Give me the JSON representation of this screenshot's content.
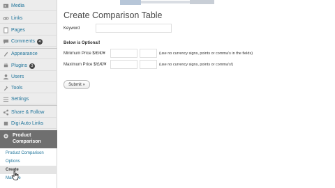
{
  "sidebar": {
    "items": [
      {
        "label": "Media",
        "icon": "media-icon"
      },
      {
        "label": "Links",
        "icon": "links-icon"
      },
      {
        "label": "Pages",
        "icon": "pages-icon"
      },
      {
        "label": "Comments",
        "icon": "comments-icon",
        "badge": "4"
      },
      {
        "label": "Appearance",
        "icon": "appearance-icon"
      },
      {
        "label": "Plugins",
        "icon": "plugins-icon",
        "badge": "3"
      },
      {
        "label": "Users",
        "icon": "users-icon"
      },
      {
        "label": "Tools",
        "icon": "tools-icon"
      },
      {
        "label": "Settings",
        "icon": "settings-icon"
      },
      {
        "label": "Share & Follow",
        "icon": "share-icon"
      },
      {
        "label": "Digi Auto Links",
        "icon": "links-plugin-icon"
      }
    ],
    "active_group": {
      "label_line1": "Product",
      "label_line2": "Comparison"
    },
    "submenu": [
      "Product Comparison",
      "Options",
      "Create",
      "Manage"
    ]
  },
  "main": {
    "title": "Create Comparison Table",
    "keyword_label": "Keyword",
    "optional_heading": "Below is Optional!",
    "min_price_label": "Minimum Price  $/£/€/¥",
    "max_price_label": "Maximum Price  $/£/€/¥",
    "min_note": "(use no currency signs, points or comma's in the fields)",
    "max_note": "(use no currency signs, points or comma's!)",
    "submit_label": "Submit »"
  },
  "colors": {
    "link": "#21759b",
    "active_bg": "#6f6f6f",
    "sidebar_bg": "#ececec"
  }
}
